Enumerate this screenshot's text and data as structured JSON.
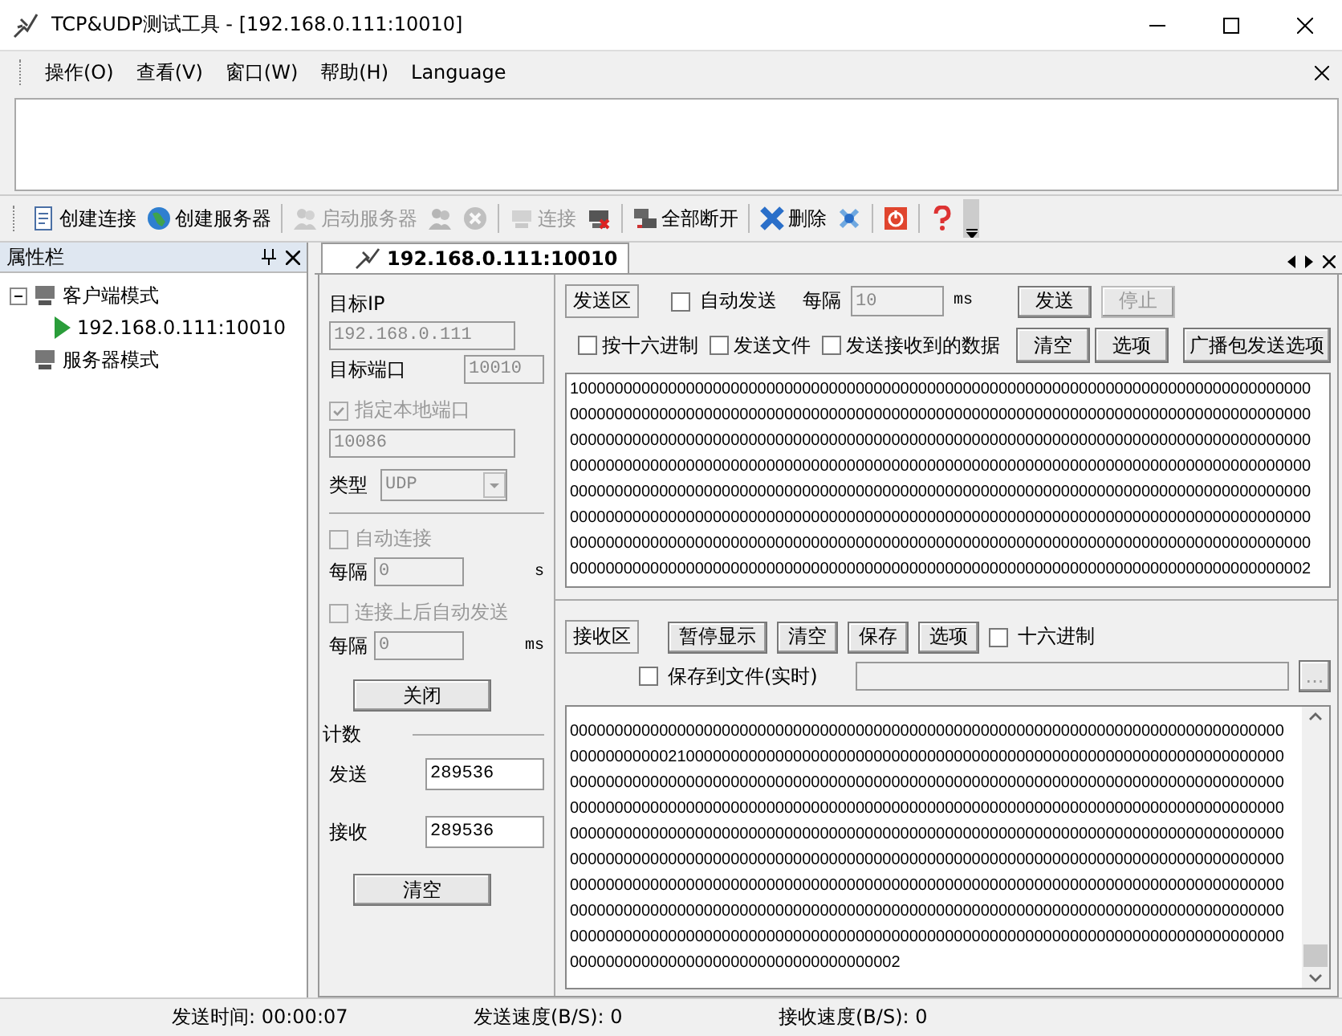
{
  "window": {
    "title": "TCP&UDP测试工具 - [192.168.0.111:10010]"
  },
  "menu": [
    {
      "label": "操作(O)"
    },
    {
      "label": "查看(V)"
    },
    {
      "label": "窗口(W)"
    },
    {
      "label": "帮助(H)"
    },
    {
      "label": "Language"
    }
  ],
  "toolbar": [
    {
      "kind": "button",
      "label": "创建连接",
      "disabled": false
    },
    {
      "kind": "button",
      "label": "创建服务器",
      "disabled": false
    },
    {
      "kind": "separator"
    },
    {
      "kind": "button",
      "label": "启动服务器",
      "disabled": true
    },
    {
      "kind": "button",
      "disabled": true
    },
    {
      "kind": "button",
      "disabled": true
    },
    {
      "kind": "separator"
    },
    {
      "kind": "button",
      "label": "连接",
      "disabled": true
    },
    {
      "kind": "button",
      "disabled": false
    },
    {
      "kind": "separator"
    },
    {
      "kind": "button",
      "label": "全部断开",
      "disabled": false
    },
    {
      "kind": "separator"
    },
    {
      "kind": "button",
      "label": "删除",
      "disabled": false
    },
    {
      "kind": "button",
      "disabled": false
    },
    {
      "kind": "separator"
    },
    {
      "kind": "button",
      "disabled": false
    },
    {
      "kind": "separator"
    },
    {
      "kind": "button",
      "disabled": false
    }
  ],
  "sidebar": {
    "title": "属性栏",
    "tree": [
      {
        "label": "客户端模式",
        "expanded": true,
        "children": [
          {
            "label": "192.168.0.111:10010"
          }
        ]
      },
      {
        "label": "服务器模式"
      }
    ]
  },
  "tabs": [
    {
      "label": "192.168.0.111:10010",
      "selected": true
    }
  ],
  "connection": {
    "target_ip": {
      "label": "目标IP",
      "value": "192.168.0.111"
    },
    "target_port": {
      "label": "目标端口",
      "value": "10010"
    },
    "local_port": {
      "label": "指定本地端口",
      "checked": true,
      "disabled": true,
      "value": "10086"
    },
    "type": {
      "label": "类型",
      "value": "UDP"
    },
    "auto_connect": {
      "label": "自动连接",
      "checked": false,
      "disabled": true,
      "interval_label": "每隔",
      "interval": "0",
      "unit": "s"
    },
    "auto_send": {
      "label": "连接上后自动发送",
      "checked": false,
      "disabled": true,
      "interval_label": "每隔",
      "interval": "0",
      "unit": "ms"
    },
    "close_button": "关闭",
    "counts": {
      "title": "计数",
      "sent_label": "发送",
      "sent": "289536",
      "received_label": "接收",
      "received": "289536",
      "clear_button": "清空"
    }
  },
  "send": {
    "title": "发送区",
    "auto_send": {
      "label": "自动发送",
      "checked": false
    },
    "interval_label": "每隔",
    "interval": "10",
    "unit": "ms",
    "buttons": [
      {
        "label": "发送",
        "disabled": false
      },
      {
        "label": "停止",
        "disabled": true
      }
    ],
    "options": [
      {
        "label": "按十六进制",
        "checked": false
      },
      {
        "label": "发送文件",
        "checked": false
      },
      {
        "label": "发送接收到的数据",
        "checked": false
      }
    ],
    "buttons2": [
      {
        "label": "清空",
        "disabled": false
      },
      {
        "label": "选项",
        "disabled": false
      }
    ],
    "broadcast_button": "广播包发送选项",
    "lines": [
      "10000000000000000000000000000000000000000000000000000000000000000000000000000000000",
      "00000000000000000000000000000000000000000000000000000000000000000000000000000000000",
      "00000000000000000000000000000000000000000000000000000000000000000000000000000000000",
      "00000000000000000000000000000000000000000000000000000000000000000000000000000000000",
      "00000000000000000000000000000000000000000000000000000000000000000000000000000000000",
      "00000000000000000000000000000000000000000000000000000000000000000000000000000000000",
      "00000000000000000000000000000000000000000000000000000000000000000000000000000000000",
      "00000000000000000000000000000000000000000000000000000000000000000000000000000000002"
    ]
  },
  "receive": {
    "title": "接收区",
    "buttons": [
      {
        "label": "暂停显示"
      },
      {
        "label": "清空"
      },
      {
        "label": "保存"
      },
      {
        "label": "选项"
      }
    ],
    "hex": {
      "label": "十六进制",
      "checked": false
    },
    "save_to_file": {
      "label": "保存到文件(实时)",
      "checked": false
    },
    "browse_button": "...",
    "lines": [
      "00000000000000000000000000000000000000000000000000000000000000000000000000000000",
      "00000000000210000000000000000000000000000000000000000000000000000000000000000000",
      "00000000000000000000000000000000000000000000000000000000000000000000000000000000",
      "00000000000000000000000000000000000000000000000000000000000000000000000000000000",
      "00000000000000000000000000000000000000000000000000000000000000000000000000000000",
      "00000000000000000000000000000000000000000000000000000000000000000000000000000000",
      "00000000000000000000000000000000000000000000000000000000000000000000000000000000",
      "00000000000000000000000000000000000000000000000000000000000000000000000000000000",
      "00000000000000000000000000000000000000000000000000000000000000000000000000000000",
      "0000000000000000000000000000000000002"
    ]
  },
  "status_bar": [
    "发送时间: 00:00:07",
    "发送速度(B/S): 0",
    "接收速度(B/S): 0"
  ]
}
